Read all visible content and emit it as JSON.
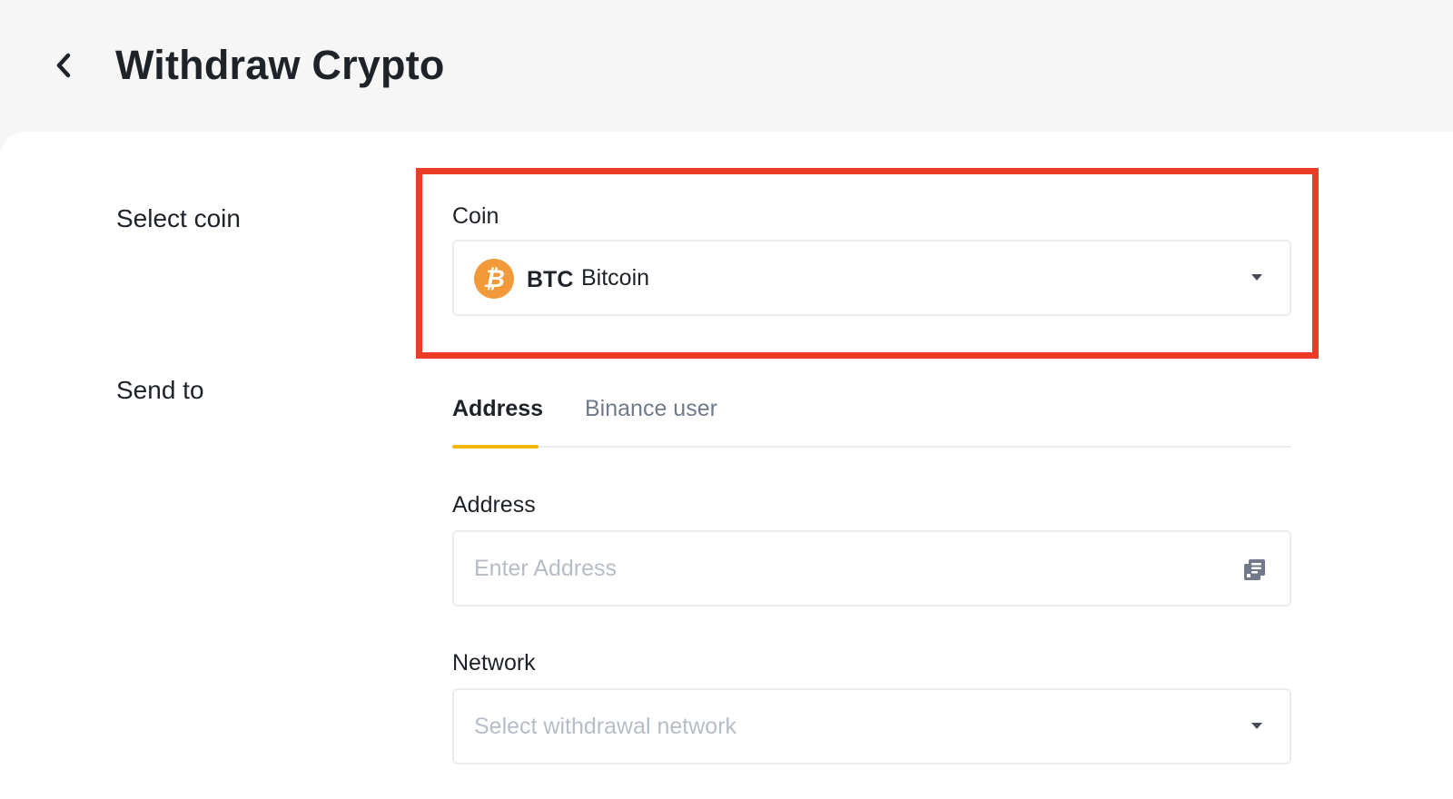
{
  "header": {
    "back_icon": "chevron-left-icon",
    "title": "Withdraw Crypto"
  },
  "select_coin": {
    "section_label": "Select coin",
    "field_label": "Coin",
    "selected": {
      "logo_icon": "bitcoin-icon",
      "logo_glyph": "₿",
      "symbol": "BTC",
      "name": "Bitcoin"
    },
    "highlight_color": "#ec3b27"
  },
  "send_to": {
    "section_label": "Send to",
    "tabs": [
      {
        "label": "Address",
        "active": true
      },
      {
        "label": "Binance user",
        "active": false
      }
    ],
    "address": {
      "label": "Address",
      "placeholder": "Enter Address",
      "icon": "address-book-icon"
    },
    "network": {
      "label": "Network",
      "placeholder": "Select withdrawal network"
    }
  },
  "colors": {
    "accent": "#f0b90b",
    "bitcoin": "#f29a3a",
    "text": "#1e2329",
    "muted": "#707a8a",
    "placeholder": "#b7bdc6"
  }
}
